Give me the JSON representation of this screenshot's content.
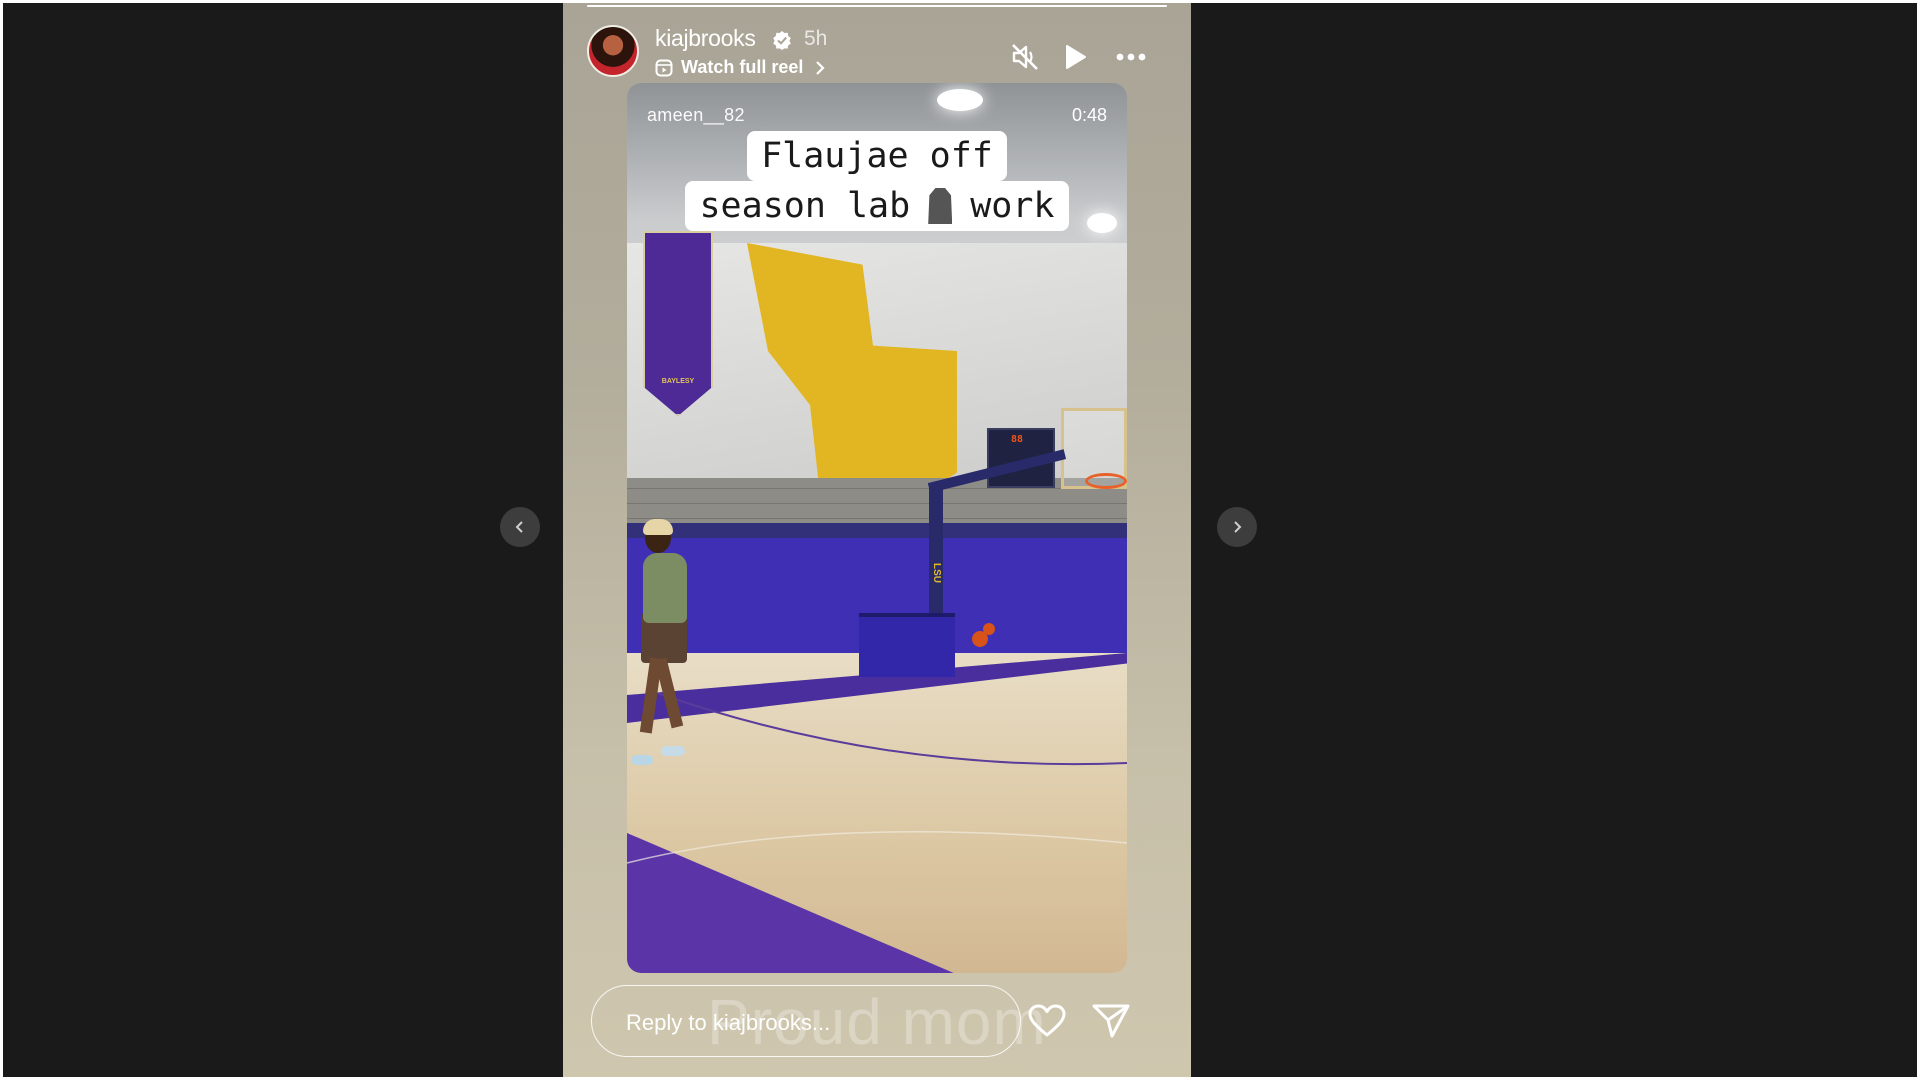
{
  "story": {
    "username": "kiajbrooks",
    "verified": true,
    "time_ago": "5h",
    "reel_link_label": "Watch full reel",
    "icons": {
      "mute": "muted-speaker-icon",
      "play": "play-icon",
      "more": "more-options-icon",
      "reel": "reel-icon",
      "chevron": "chevron-right-icon"
    }
  },
  "video": {
    "author": "ameen__82",
    "timestamp": "0:48",
    "caption_line1": "Flaujae off",
    "caption_line2_before": "season lab",
    "caption_line2_after": "work",
    "caption_emoji_name": "lab-coat-emoji",
    "banner_text": "BAYLESY",
    "pole_text": "LSU",
    "scoreboard_text": "88"
  },
  "footer": {
    "reply_placeholder": "Reply to kiajbrooks...",
    "overlay_text": "Proud mom",
    "icons": {
      "like": "heart-icon",
      "share": "send-icon"
    }
  },
  "navigation": {
    "prev": "chevron-left-icon",
    "next": "chevron-right-icon"
  },
  "colors": {
    "viewer_bg": "#1a1a1a",
    "lsu_purple": "#3e2fb4",
    "lsu_gold": "#e2b523"
  }
}
